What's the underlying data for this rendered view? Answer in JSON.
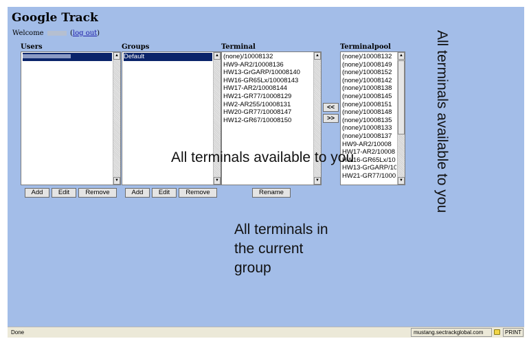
{
  "app": {
    "title": "Google Track",
    "welcome_prefix": "Welcome",
    "logout": "log out"
  },
  "columns": {
    "users": "Users",
    "groups": "Groups",
    "terminal": "Terminal",
    "terminalpool": "Terminalpool"
  },
  "users": {
    "items": []
  },
  "groups": {
    "items": [
      "Default"
    ]
  },
  "terminal": {
    "items": [
      "(none)/10008132",
      "HW9-AR2/10008136",
      "HW13-GrGARP/10008140",
      "HW16-GR65Lx/10008143",
      "HW17-AR2/10008144",
      "HW21-GR77/10008129",
      "HW2-AR255/10008131",
      "HW20-GR77/10008147",
      "HW12-GR67/10008150"
    ]
  },
  "terminalpool": {
    "items": [
      "(none)/10008132",
      "(none)/10008149",
      "(none)/10008152",
      "(none)/10008142",
      "(none)/10008138",
      "(none)/10008145",
      "(none)/10008151",
      "(none)/10008148",
      "(none)/10008135",
      "(none)/10008133",
      "(none)/10008137",
      "HW9-AR2/10008",
      "HW17-AR2/10008",
      "HW16-GR65Lx/10",
      "HW13-GrGARP/10",
      "HW21-GR77/1000"
    ]
  },
  "buttons": {
    "add": "Add",
    "edit": "Edit",
    "remove": "Remove",
    "rename": "Rename",
    "move_left": "<<",
    "move_right": ">>"
  },
  "annotations": {
    "vertical": "All terminals available to you",
    "middle": "All terminals available to you",
    "group_line1": "All terminals in",
    "group_line2": "the current",
    "group_line3": "group"
  },
  "status": {
    "text": "Done",
    "host": "mustang.sectrackglobal.com",
    "print": "PRINT"
  },
  "colors": {
    "page_bg": "#a3bde8",
    "selection": "#0a246a"
  }
}
